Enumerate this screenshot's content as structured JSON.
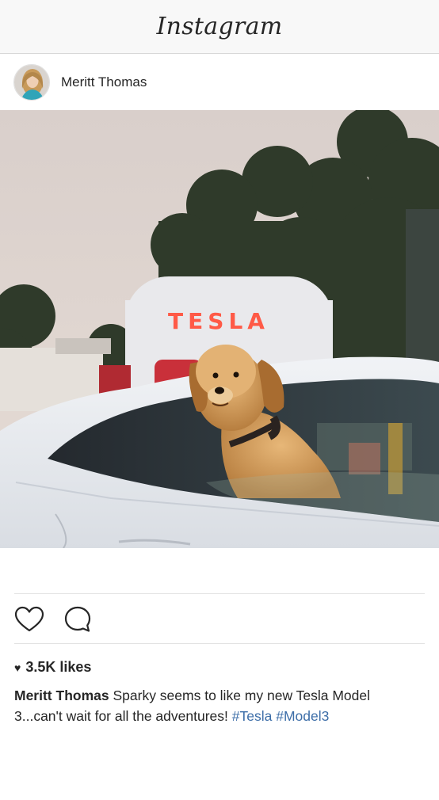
{
  "app": {
    "title": "Instagram"
  },
  "post": {
    "username": "Meritt Thomas",
    "image": {
      "sign_text": "TESLA"
    },
    "actions": {
      "like_icon": "heart-outline-icon",
      "comment_icon": "comment-bubble-icon"
    },
    "likes": {
      "icon": "heart-filled-icon",
      "text": "3.5K likes"
    },
    "caption": {
      "username": "Meritt Thomas",
      "text": "Sparky seems to like my new Tesla Model 3...can't wait for all the adventures!",
      "hashtags": [
        "#Tesla",
        "#Model3"
      ]
    }
  }
}
